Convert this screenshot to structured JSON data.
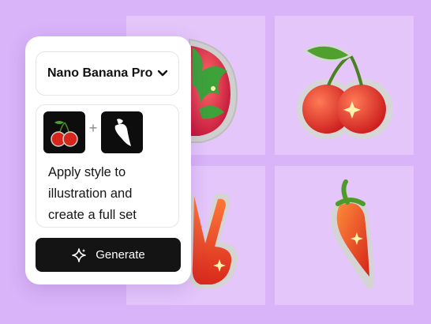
{
  "panel": {
    "model_select": {
      "label": "Nano Banana Pro",
      "icon": "chevron-down-icon"
    },
    "prompt": {
      "reference_images": [
        "cherries-sticker-thumbnail",
        "pepper-silhouette-thumbnail"
      ],
      "plus_symbol": "+",
      "lines": [
        "Apply style to",
        "illustration and",
        "create a full set"
      ]
    },
    "generate_button": {
      "label": "Generate",
      "icon": "sparkle-icon"
    }
  },
  "gallery": {
    "tiles": [
      "dragon-fruit-sticker",
      "cherries-sticker",
      "peace-hand-sticker",
      "chili-pepper-sticker"
    ]
  },
  "colors": {
    "background": "#d9b4f9",
    "tile": "#e4c6fb",
    "button": "#141414",
    "sticker_red": "#e8321e"
  }
}
